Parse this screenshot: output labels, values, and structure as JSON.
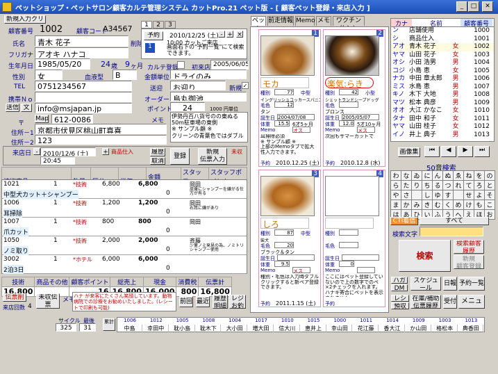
{
  "title": "ペットショップ・ペットサロン顧客カルテ管理システム カットPro.21 ペット版 - [ 顧客ペット登録・来店入力 ]",
  "toolbar_top": "新規入力クリア",
  "customer": {
    "no_label": "顧客番号",
    "no": "1002",
    "code_label": "顧客コード",
    "code": "A34567",
    "name_label": "氏名",
    "name": "青木 花子",
    "delete_label": "削除",
    "kana_label": "フリガナ",
    "kana": "アオキ ハナコ",
    "birth_label": "生年月日",
    "birth": "1985/05/20",
    "age": "24",
    "age_unit": "歳",
    "months": "9",
    "month_unit": "ヶ月",
    "sex_label": "性別",
    "sex": "女",
    "blood_label": "血液型",
    "blood": "B",
    "tax_label": "金額単位",
    "tax": "ドライのみ",
    "tel_label": "TEL",
    "tel": "0751234567",
    "send_label": "送迎",
    "send": "お迎り",
    "new_label": "新規",
    "mobile_label": "携帯Ｎｏ",
    "order_label": "オーダー",
    "order": "烏丸御池",
    "mail_send": "送信",
    "mail_text": "文",
    "mail": "info@msjapan.jp",
    "point_label": "ポイント",
    "point": "24",
    "point_note": "1000 円単位",
    "zip_label": "〒",
    "map_btn": "Map",
    "zip": "612-0086",
    "memo_label": "メモ",
    "addr_label": "住所－1",
    "addr1": "京都市伏見区桃山町真喜",
    "addr_label2": "住所－2",
    "addr2": "123",
    "memo": "伊勢丹百八貨号のの東ぬる 50m駐車場の東側\n※ サンプル顧 ※\nクリーンの青葉色ではダブル",
    "karte_label": "カルテ登録",
    "first_label": "初来店",
    "first": "2005/06/05"
  },
  "reserve": {
    "tabs": [
      "1",
      "2",
      "3"
    ],
    "btn": "予約",
    "date": "2010/12/25 (土)",
    "time": "10:00 カットご来店",
    "note": "画面右下の\"予約一覧\"にて検索できます。"
  },
  "visit": {
    "label": "来店日",
    "date": "2010/12/6 (土)",
    "time": "20:45",
    "product_label": "商品仕入",
    "repeat": "履歴",
    "cancel": "取消",
    "register": "登録",
    "new_slip": "新規\n伝票入力",
    "unpaid": "未収",
    "headers": [
      "技術商品",
      "数量",
      "区分",
      "単価",
      "金額\n原単価",
      "スタッフ\n粗利",
      "スタッフポイント\nメモ"
    ],
    "rows": [
      {
        "code": "1021",
        "name": "中型犬カット＋シャンプー",
        "qty": "1",
        "kind": "*技術",
        "price": "6,800",
        "amt": "6,800",
        "cost": "0",
        "profit": "6,800",
        "staff": "岡田",
        "memo": "皮膚にシャンプーを嫌がる仕方が有る"
      },
      {
        "code": "1006",
        "name": "耳掃除",
        "qty": "1",
        "kind": "*技術",
        "price": "1,200",
        "amt": "1,200",
        "cost": "0",
        "profit": "1,200",
        "staff": "岡田",
        "memo": "右耳に嫌があり"
      },
      {
        "code": "1007",
        "name": "爪カット",
        "qty": "1",
        "kind": "*技術",
        "price": "800",
        "amt": "800",
        "cost": "0",
        "profit": "800",
        "staff": "岡田",
        "memo": ""
      },
      {
        "code": "1050",
        "name": "ノミ取り",
        "qty": "1",
        "kind": "*技術",
        "price": "2,000",
        "amt": "2,000",
        "cost": "0",
        "profit": "2,000",
        "staff": "斉藤",
        "memo": "少量ノミ発見の為、ノミトリシャンプー使用"
      },
      {
        "code": "3002",
        "name": "2泊3日",
        "qty": "1",
        "kind": "*ホテル",
        "price": "6,000",
        "amt": "6,000",
        "cost": "0",
        "profit": "6,000",
        "staff": "",
        "memo": ""
      }
    ],
    "total_headers": [
      "技術",
      "商品その他",
      "顧客ポイント",
      "総売上",
      "現金",
      "消費税",
      "伝票計"
    ],
    "totals": [
      "16,800",
      "",
      "16",
      "16,800",
      "16,000",
      "800",
      "16,800"
    ],
    "footer_btns": [
      "伝票削除",
      "未収伝票\n一覧",
      "メモ",
      "前回",
      "最近",
      "履歴\n明細",
      "レジ\nお釣り"
    ],
    "footer_memo": "ハナ が来客にたくさん笑顔しています。動物病院での診療をお勧めいたしました。(レシートで印刷も可能)",
    "visits_label": "来店回数",
    "visits": "4",
    "cycle_label": "サイクル",
    "cycle": "325",
    "days_label": "最後",
    "days": "31",
    "total_label": "累計"
  },
  "pet_tabs": [
    "ペット",
    "前走情報",
    "Memo",
    "メモ",
    "ワクチン仕入れ"
  ],
  "pets": [
    {
      "num": "1",
      "name": "モカ",
      "kind_label": "種別",
      "kind": "77",
      "size": "中型",
      "breed": "イングリッシュコッカースパニエル",
      "color_label": "毛色",
      "color": "12",
      "color_name": "タン",
      "birth_label": "誕生日",
      "birth": "2004/07/08",
      "age": "6才5ヶ月",
      "weight_label": "体重",
      "weight": "15.5",
      "memo_label": "Memo",
      "sex": "オス",
      "note": "耳掃除必須\n※ サンプル顧 ※\n上部のMemoタブで拡大性入力できます。",
      "res_label": "予約",
      "res": "2010.12.25 (土)"
    },
    {
      "num": "2",
      "name": "楽気:らき",
      "kind_label": "種別",
      "kind": "42",
      "size": "小型",
      "breed": "シェットランドシープドッグ",
      "color_label": "毛色",
      "color": "",
      "color_name": "ブロンス",
      "birth_label": "誕生日",
      "birth": "2005/05/07",
      "age": "5才10ヶ月",
      "weight_label": "体重",
      "weight": "12.0",
      "memo_label": "Memo",
      "sex": "メス",
      "note": "次回もサマーカットで",
      "res_label": "予約",
      "res": "2010.12.8 (水)"
    },
    {
      "num": "3",
      "name": "しろ",
      "kind_label": "種別",
      "kind": "87",
      "size": "中型",
      "breed": "柴犬",
      "color_label": "毛色",
      "color": "20",
      "color_name": "ブラック＆タン",
      "birth_label": "誕生日",
      "birth": "",
      "age": "",
      "weight_label": "体重",
      "weight": "9.5",
      "memo_label": "Memo",
      "sex": "メス",
      "note": "種別・毛色は入力時ダブルクリックすると新ペア登録できます。",
      "res_label": "予約",
      "res": "2011.1.15 (土)"
    },
    {
      "num": "4",
      "name": "",
      "kind_label": "種別",
      "kind": "",
      "size": "",
      "breed": "",
      "color_label": "毛色",
      "color": "",
      "color_name": "",
      "birth_label": "誕生日",
      "birth": "",
      "age": "",
      "weight_label": "体重",
      "weight": "0",
      "memo_label": "Memo",
      "sex": "",
      "note": "ここにはペット登録していないので上の数字でのペ×2チェックを入れます。ハナキ寄合にペットを表示されません。",
      "res_label": "予約",
      "res": ""
    }
  ],
  "customer_list": {
    "headers": [
      "カナ",
      "名前",
      "顧客番号"
    ],
    "rows": [
      [
        "ン",
        "店舗使用",
        "1000"
      ],
      [
        "シ",
        "商品仕入",
        "1001"
      ],
      [
        "アオ",
        "青木 花子",
        "1002"
      ],
      [
        "ヤマ",
        "山田 花子",
        "1003"
      ],
      [
        "オシ",
        "小田 浩男",
        "1004"
      ],
      [
        "コジ",
        "小島 恵",
        "1005"
      ],
      [
        "ナカ",
        "中田 章太郎",
        "1006"
      ],
      [
        "ミス",
        "水島 恵",
        "1007"
      ],
      [
        "キノ",
        "木下 大地",
        "1008"
      ],
      [
        "マツ",
        "松本 典彦",
        "1009"
      ],
      [
        "オオ",
        "大江 かなこ",
        "1010"
      ],
      [
        "タナ",
        "田中 和子",
        "1011"
      ],
      [
        "ヤマ",
        "山田 桂子",
        "1012"
      ],
      [
        "イノ",
        "井上 典子",
        "1013"
      ]
    ],
    "sexes": [
      "",
      "",
      "女",
      "女",
      "男",
      "女",
      "男",
      "男",
      "男",
      "男",
      "女",
      "女",
      "女",
      "男"
    ],
    "image_btn": "画像集",
    "kana_label": "50音検索",
    "kana": [
      "わ",
      "ら",
      "や",
      "ま",
      "は",
      "な",
      "た",
      "さ",
      "か",
      "あ",
      "ゐ",
      "り",
      "",
      "み",
      "ひ",
      "に",
      "ち",
      "し",
      "き",
      "い",
      "ん",
      "る",
      "ゆ",
      "む",
      "ふ",
      "ぬ",
      "つ",
      "す",
      "く",
      "う",
      "ゑ",
      "れ",
      "",
      "め",
      "へ",
      "ね",
      "て",
      "せ",
      "け",
      "え",
      "を",
      "ろ",
      "よ",
      "も",
      "ほ",
      "の",
      "と",
      "そ",
      "こ",
      "お"
    ],
    "cti": "CTI着信",
    "all": "すべて",
    "search_label": "検索文字",
    "search": "検索",
    "kana_search": "検索顧客\n履歴",
    "new_search": "新規\n顧客登録"
  },
  "right_btns": [
    "ハガキ",
    "DM",
    "レシート",
    "預収書",
    "スケジュール\n一覧",
    "在庫/補助\n伝票履歴",
    "日報",
    "受付",
    "予約一覧",
    "メニュー"
  ],
  "staff_list": {
    "codes": [
      "1006",
      "1012",
      "1005",
      "1008",
      "1004",
      "1017",
      "1010",
      "1015",
      "1000",
      "1011",
      "1014",
      "1009",
      "1003",
      "1013"
    ],
    "names": [
      "中島",
      "幸田中",
      "耽小島",
      "耽木下",
      "大小田",
      "増大田",
      "信大川",
      "恵井上",
      "幸山田",
      "花江藤",
      "香大江",
      "か山田",
      "格松本",
      "典香田"
    ]
  }
}
